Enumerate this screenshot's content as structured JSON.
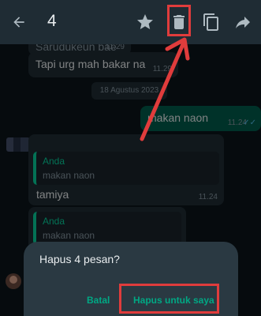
{
  "header": {
    "selected_count": "4",
    "icons": [
      "back-arrow-icon",
      "star-icon",
      "trash-icon",
      "copy-icon",
      "forward-icon"
    ]
  },
  "messages": [
    {
      "text": "Sarudukeun bae",
      "time": "11.29",
      "type": "incoming"
    },
    {
      "text": "Tapi urg mah bakar na",
      "time": "11.29",
      "type": "incoming"
    },
    {
      "text": "makan naon",
      "time": "11.24",
      "type": "outgoing"
    },
    {
      "quote_author": "Anda",
      "quote_text": "makan naon",
      "text": "tamiya",
      "time": "11.24",
      "type": "incoming"
    },
    {
      "quote_author": "Anda",
      "quote_text": "makan naon",
      "type": "incoming"
    }
  ],
  "date_separator": "18 Agustus 2023",
  "dialog": {
    "title": "Hapus 4 pesan?",
    "cancel_label": "Batal",
    "delete_label": "Hapus untuk saya"
  },
  "colors": {
    "accent": "#00a884",
    "annotation": "#e03c3c",
    "header_bg": "#1f2c34",
    "outgoing_bubble": "#005c4b"
  }
}
